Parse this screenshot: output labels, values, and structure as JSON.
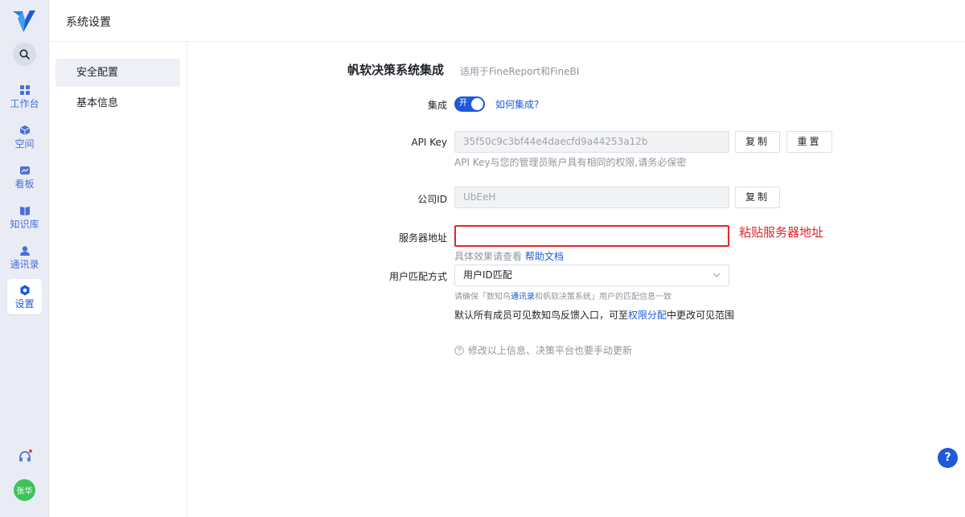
{
  "rail": {
    "search_icon": "search-icon",
    "items": [
      {
        "label": "工作台",
        "icon": "grid-icon"
      },
      {
        "label": "空间",
        "icon": "cube-icon"
      },
      {
        "label": "看板",
        "icon": "dashboard-icon"
      },
      {
        "label": "知识库",
        "icon": "book-icon"
      },
      {
        "label": "通讯录",
        "icon": "contacts-icon"
      },
      {
        "label": "设置",
        "icon": "gear-icon"
      }
    ],
    "avatar_text": "张华"
  },
  "header": {
    "title": "系统设置"
  },
  "submenu": {
    "items": [
      {
        "label": "安全配置"
      },
      {
        "label": "基本信息"
      }
    ]
  },
  "form": {
    "title": "帆软决策系统集成",
    "subtitle": "适用于FineReport和FineBI",
    "integration": {
      "label": "集成",
      "toggle_text": "开",
      "link": "如何集成?"
    },
    "api_key": {
      "label": "API Key",
      "value": "35f50c9c3bf44e4daecfd9a44253a12b",
      "copy": "复制",
      "reset": "重置",
      "hint": "API Key与您的管理员账户具有相同的权限,请务必保密"
    },
    "company_id": {
      "label": "公司ID",
      "value": "UbEeH",
      "copy": "复制"
    },
    "server": {
      "label": "服务器地址",
      "value": "",
      "note": "粘贴服务器地址",
      "hint_prefix": "具体效果请查看",
      "hint_link": "帮助文档"
    },
    "match": {
      "label": "用户匹配方式",
      "value": "用户ID匹配",
      "hint_prefix": "请确保「数知鸟",
      "hint_link": "通讯录",
      "hint_suffix": "和帆软决策系统」用户的匹配信息一致"
    },
    "permission": {
      "prefix": "默认所有成员可见数知鸟反馈入口，可至",
      "link": "权限分配",
      "suffix": "中更改可见范围"
    },
    "update_note": "修改以上信息、决策平台也要手动更新"
  },
  "help_fab": "?",
  "colors": {
    "accent": "#1e5ad9",
    "error": "#e0262b",
    "avatar": "#3ec35a"
  }
}
